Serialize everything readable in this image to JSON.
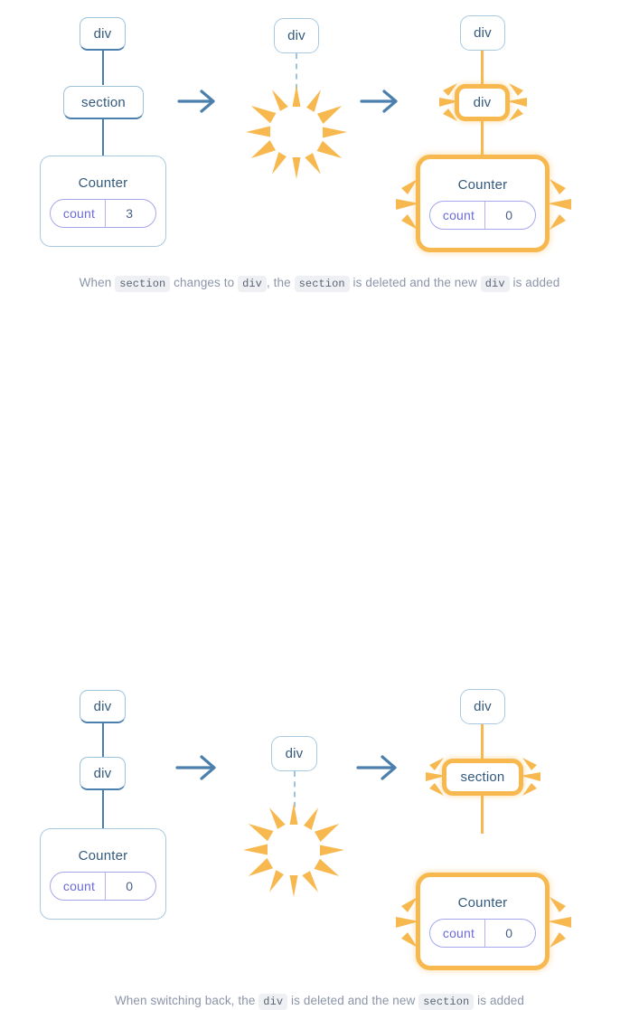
{
  "colors": {
    "node_border": "#9cc2dc",
    "node_border_bottom": "#4b7fae",
    "node_text": "#33597c",
    "highlight": "#f7b94f",
    "arrow": "#4b7fae",
    "pill_border": "#a6a6ef",
    "pill_key_text": "#6b6bd8",
    "pill_value_text": "#4b5f86",
    "caption_text": "#8b94a8",
    "code_bg": "#eef0f3",
    "background": "#ffffff"
  },
  "rows": [
    {
      "id": "row-section-to-div",
      "panels": [
        {
          "id": "before",
          "nodes": [
            {
              "label": "div",
              "state": "normal"
            },
            {
              "label": "section",
              "state": "normal"
            }
          ],
          "counter": {
            "title": "Counter",
            "state_key": "count",
            "state_value": "3",
            "highlight": false
          }
        },
        {
          "id": "during",
          "nodes": [
            {
              "label": "div",
              "state": "normal"
            }
          ],
          "effect": "burst",
          "connector": "dashed"
        },
        {
          "id": "after",
          "nodes": [
            {
              "label": "div",
              "state": "normal"
            },
            {
              "label": "div",
              "state": "highlight"
            }
          ],
          "counter": {
            "title": "Counter",
            "state_key": "count",
            "state_value": "0",
            "highlight": true
          }
        }
      ],
      "arrows": [
        "→",
        "→"
      ],
      "caption": {
        "parts": [
          {
            "type": "text",
            "value": "When "
          },
          {
            "type": "code",
            "value": "section"
          },
          {
            "type": "text",
            "value": " changes to "
          },
          {
            "type": "code",
            "value": "div"
          },
          {
            "type": "text",
            "value": ", the "
          },
          {
            "type": "code",
            "value": "section"
          },
          {
            "type": "text",
            "value": " is deleted and the new "
          },
          {
            "type": "code",
            "value": "div"
          },
          {
            "type": "text",
            "value": " is added"
          }
        ]
      }
    },
    {
      "id": "row-div-to-section",
      "panels": [
        {
          "id": "before",
          "nodes": [
            {
              "label": "div",
              "state": "normal"
            },
            {
              "label": "div",
              "state": "normal"
            }
          ],
          "counter": {
            "title": "Counter",
            "state_key": "count",
            "state_value": "0",
            "highlight": false
          }
        },
        {
          "id": "during",
          "nodes": [
            {
              "label": "div",
              "state": "normal"
            }
          ],
          "effect": "burst",
          "connector": "dashed"
        },
        {
          "id": "after",
          "nodes": [
            {
              "label": "div",
              "state": "normal"
            },
            {
              "label": "section",
              "state": "highlight"
            }
          ],
          "counter": {
            "title": "Counter",
            "state_key": "count",
            "state_value": "0",
            "highlight": true
          }
        }
      ],
      "arrows": [
        "→",
        "→"
      ],
      "caption": {
        "parts": [
          {
            "type": "text",
            "value": "When switching back, the "
          },
          {
            "type": "code",
            "value": "div"
          },
          {
            "type": "text",
            "value": " is deleted and the new "
          },
          {
            "type": "code",
            "value": "section"
          },
          {
            "type": "text",
            "value": " is added"
          }
        ]
      }
    }
  ],
  "labels": {
    "r1p1_node1": "div",
    "r1p1_node2": "section",
    "r1p1_counter_title": "Counter",
    "r1p1_count_key": "count",
    "r1p1_count_val": "3",
    "r1p2_node1": "div",
    "r1p3_node1": "div",
    "r1p3_node2": "div",
    "r1p3_counter_title": "Counter",
    "r1p3_count_key": "count",
    "r1p3_count_val": "0",
    "r2p1_node1": "div",
    "r2p1_node2": "div",
    "r2p1_counter_title": "Counter",
    "r2p1_count_key": "count",
    "r2p1_count_val": "0",
    "r2p2_node1": "div",
    "r2p3_node1": "div",
    "r2p3_node2": "section",
    "r2p3_counter_title": "Counter",
    "r2p3_count_key": "count",
    "r2p3_count_val": "0"
  }
}
